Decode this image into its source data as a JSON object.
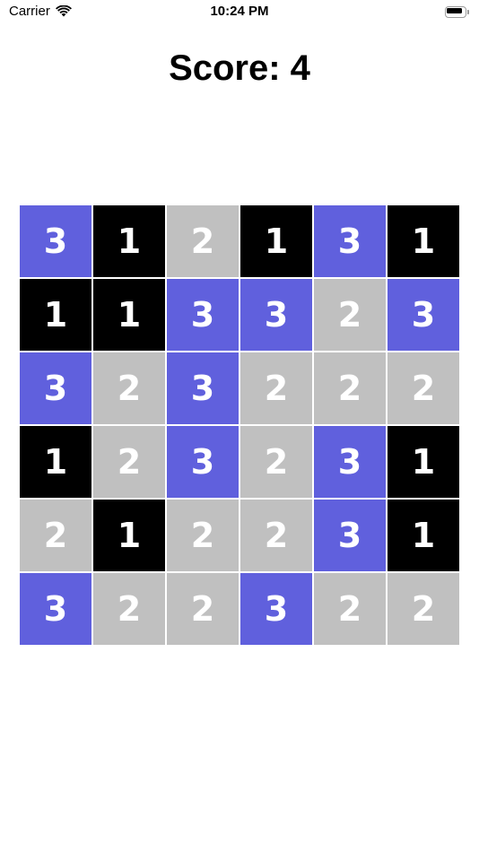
{
  "status_bar": {
    "carrier": "Carrier",
    "time": "10:24 PM"
  },
  "score_text": "Score: 4",
  "colors": {
    "1": "#000000",
    "2": "#c0c0c0",
    "3": "#6060dd",
    "text": "#ffffff"
  },
  "board": [
    [
      "3",
      "1",
      "2",
      "1",
      "3",
      "1"
    ],
    [
      "1",
      "1",
      "3",
      "3",
      "2",
      "3"
    ],
    [
      "3",
      "2",
      "3",
      "2",
      "2",
      "2"
    ],
    [
      "1",
      "2",
      "3",
      "2",
      "3",
      "1"
    ],
    [
      "2",
      "1",
      "2",
      "2",
      "3",
      "1"
    ],
    [
      "3",
      "2",
      "2",
      "3",
      "2",
      "2"
    ]
  ]
}
